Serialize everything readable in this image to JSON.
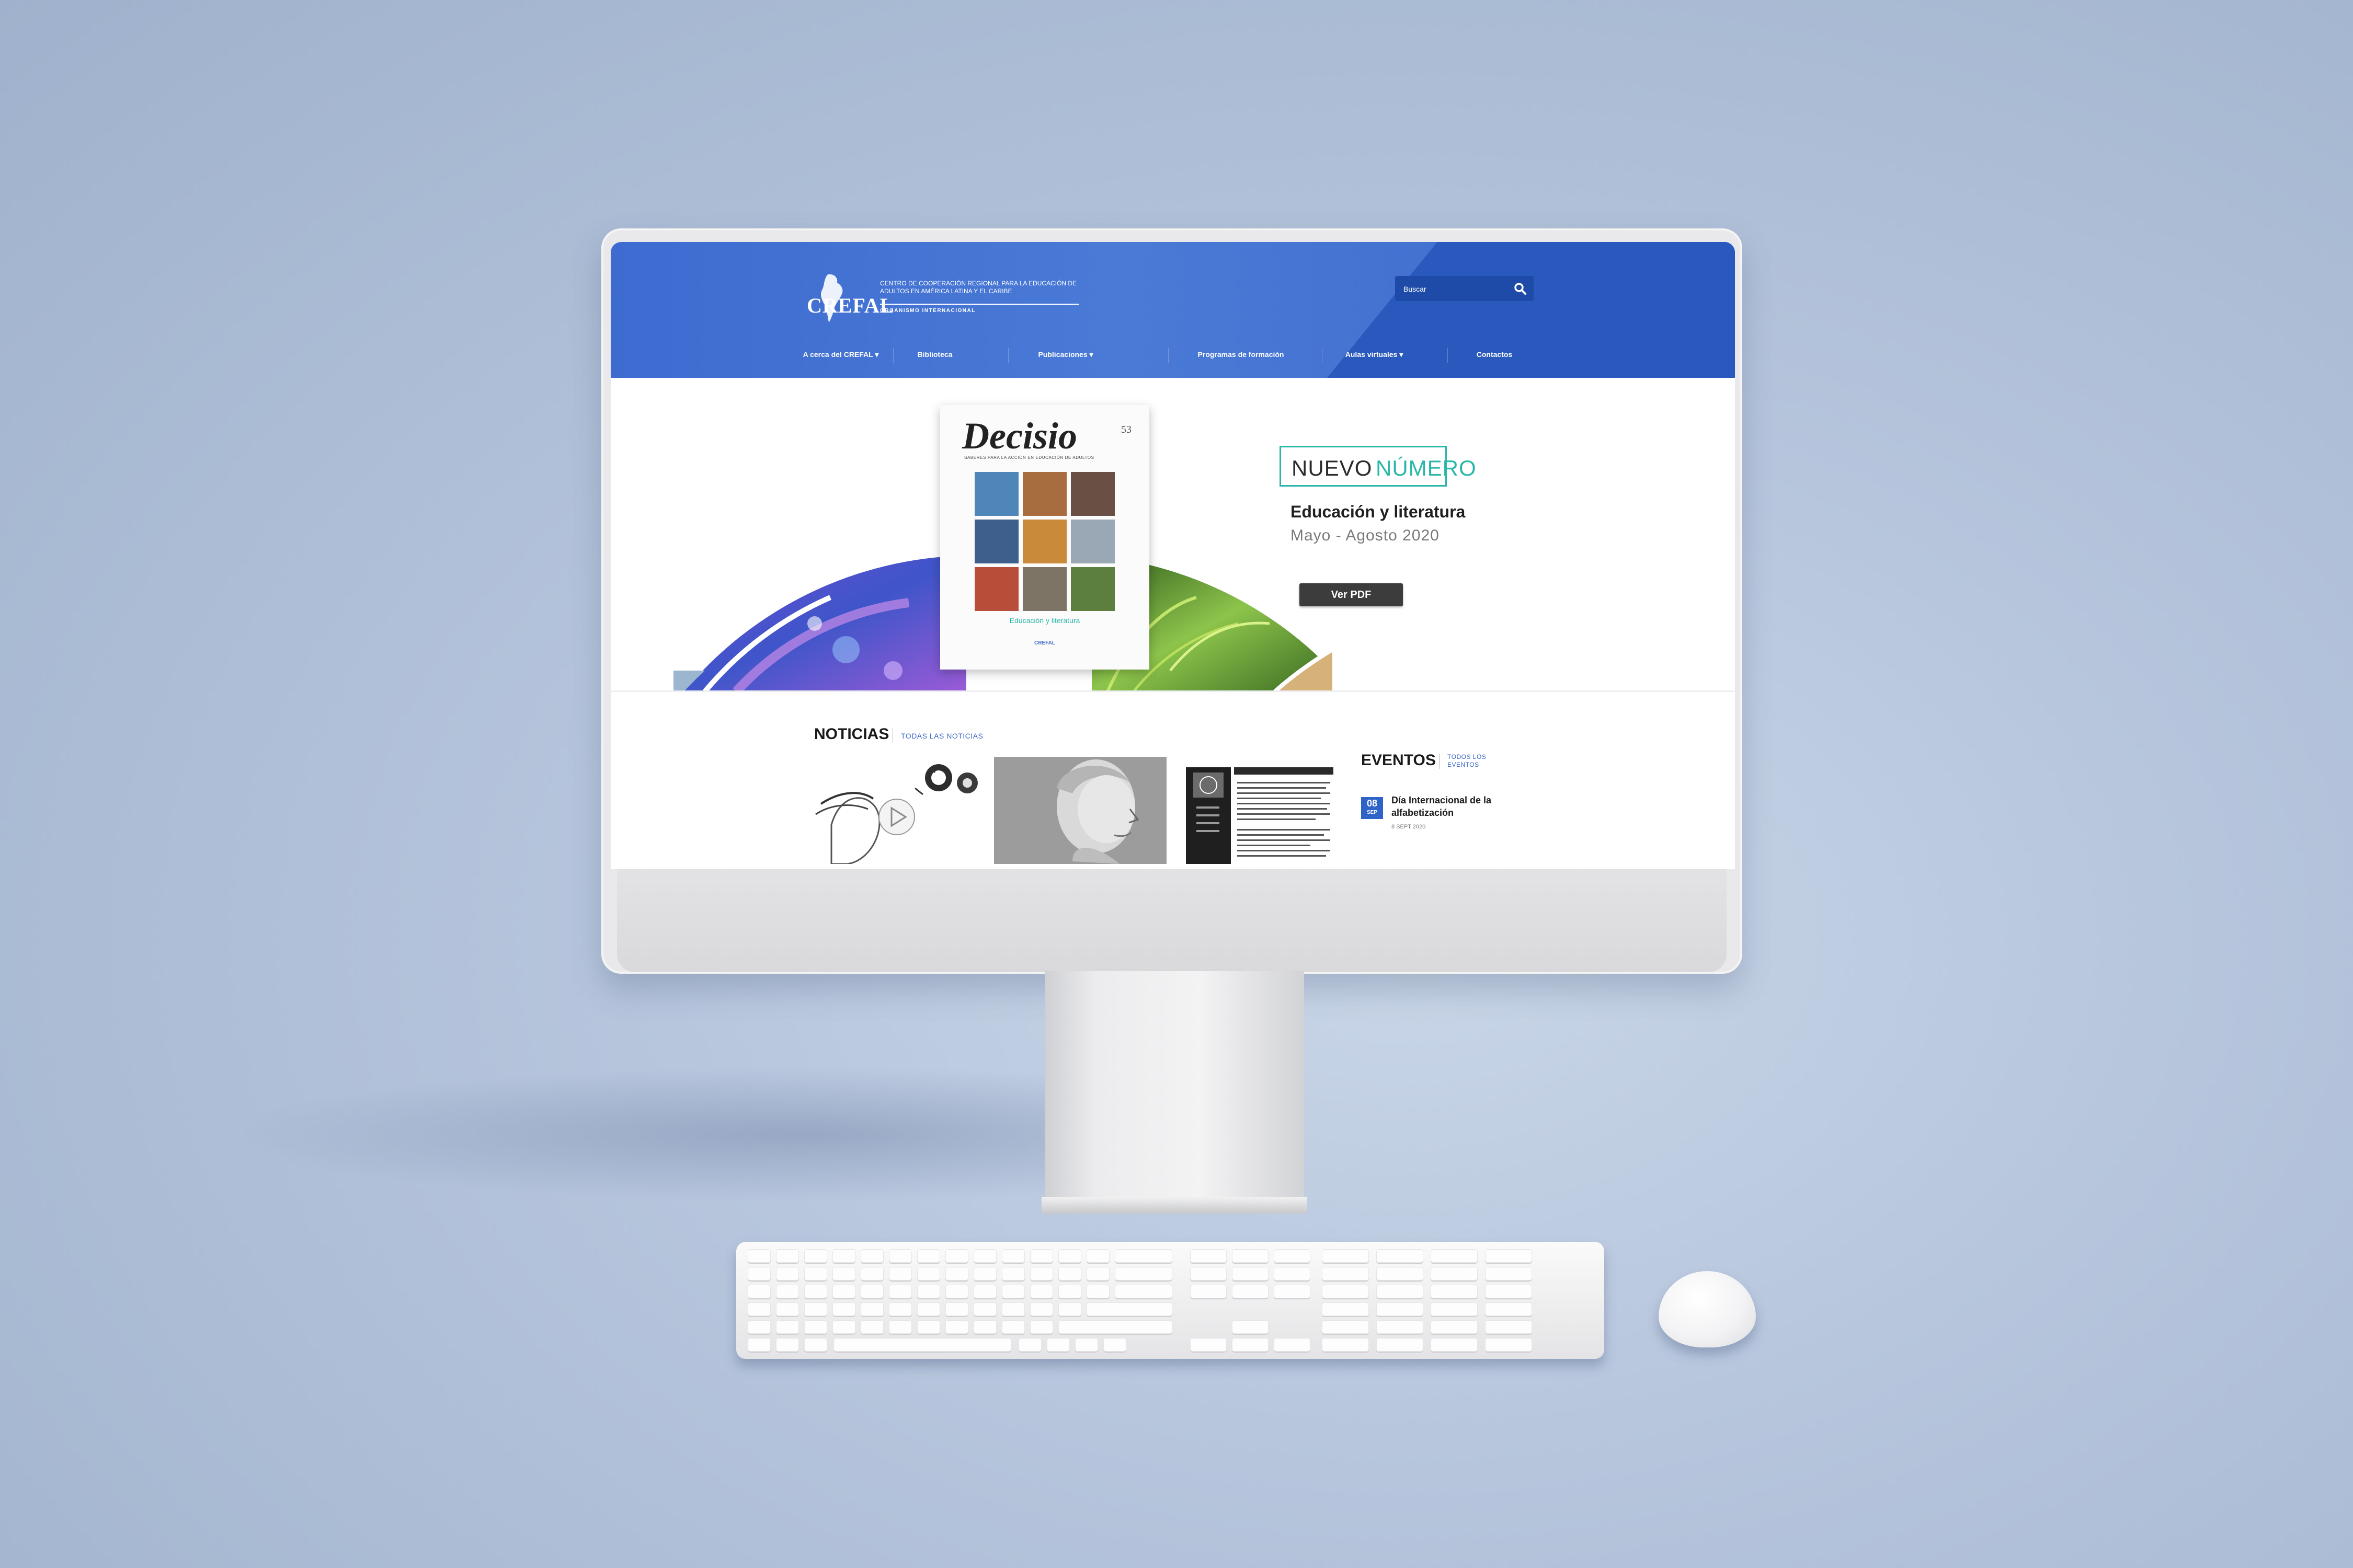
{
  "header": {
    "logo_word": "CREFAL",
    "logo_text": "Centro de Cooperación Regional para la Educación de Adultos en América Latina y el Caribe",
    "logo_sub": "ORGANISMO INTERNACIONAL",
    "search_placeholder": "Buscar",
    "nav": [
      {
        "label": "A cerca del CREFAL ▾"
      },
      {
        "label": "Biblioteca"
      },
      {
        "label": "Publicaciones ▾"
      },
      {
        "label": "Programas de formación"
      },
      {
        "label": "Aulas virtuales ▾"
      },
      {
        "label": "Contactos"
      }
    ]
  },
  "hero": {
    "magazine_title": "Decisio",
    "magazine_number": "53",
    "magazine_tagline": "SABERES PARA LA ACCIÓN EN EDUCACIÓN DE ADULTOS",
    "magazine_subtitle": "Educación y literatura",
    "magazine_logo": "CREFAL",
    "badge_a": "NUEVO",
    "badge_b": "NÚMERO",
    "title": "Educación y literatura",
    "date": "Mayo - Agosto 2020",
    "button": "Ver PDF"
  },
  "news": {
    "heading": "NOTICIAS",
    "link": "TODAS LAS NOTICIAS"
  },
  "events": {
    "heading": "EVENTOS",
    "link": "TODOS LOS EVENTOS",
    "items": [
      {
        "day": "08",
        "month": "SEP",
        "title": "Día Internacional de la alfabetización",
        "date": "8 SEPT 2020"
      }
    ]
  },
  "colors": {
    "header_blue": "#3d6bd0",
    "accent_teal": "#2ab7a9",
    "link_blue": "#3a66c4",
    "button_dark": "#3c3c3c"
  }
}
